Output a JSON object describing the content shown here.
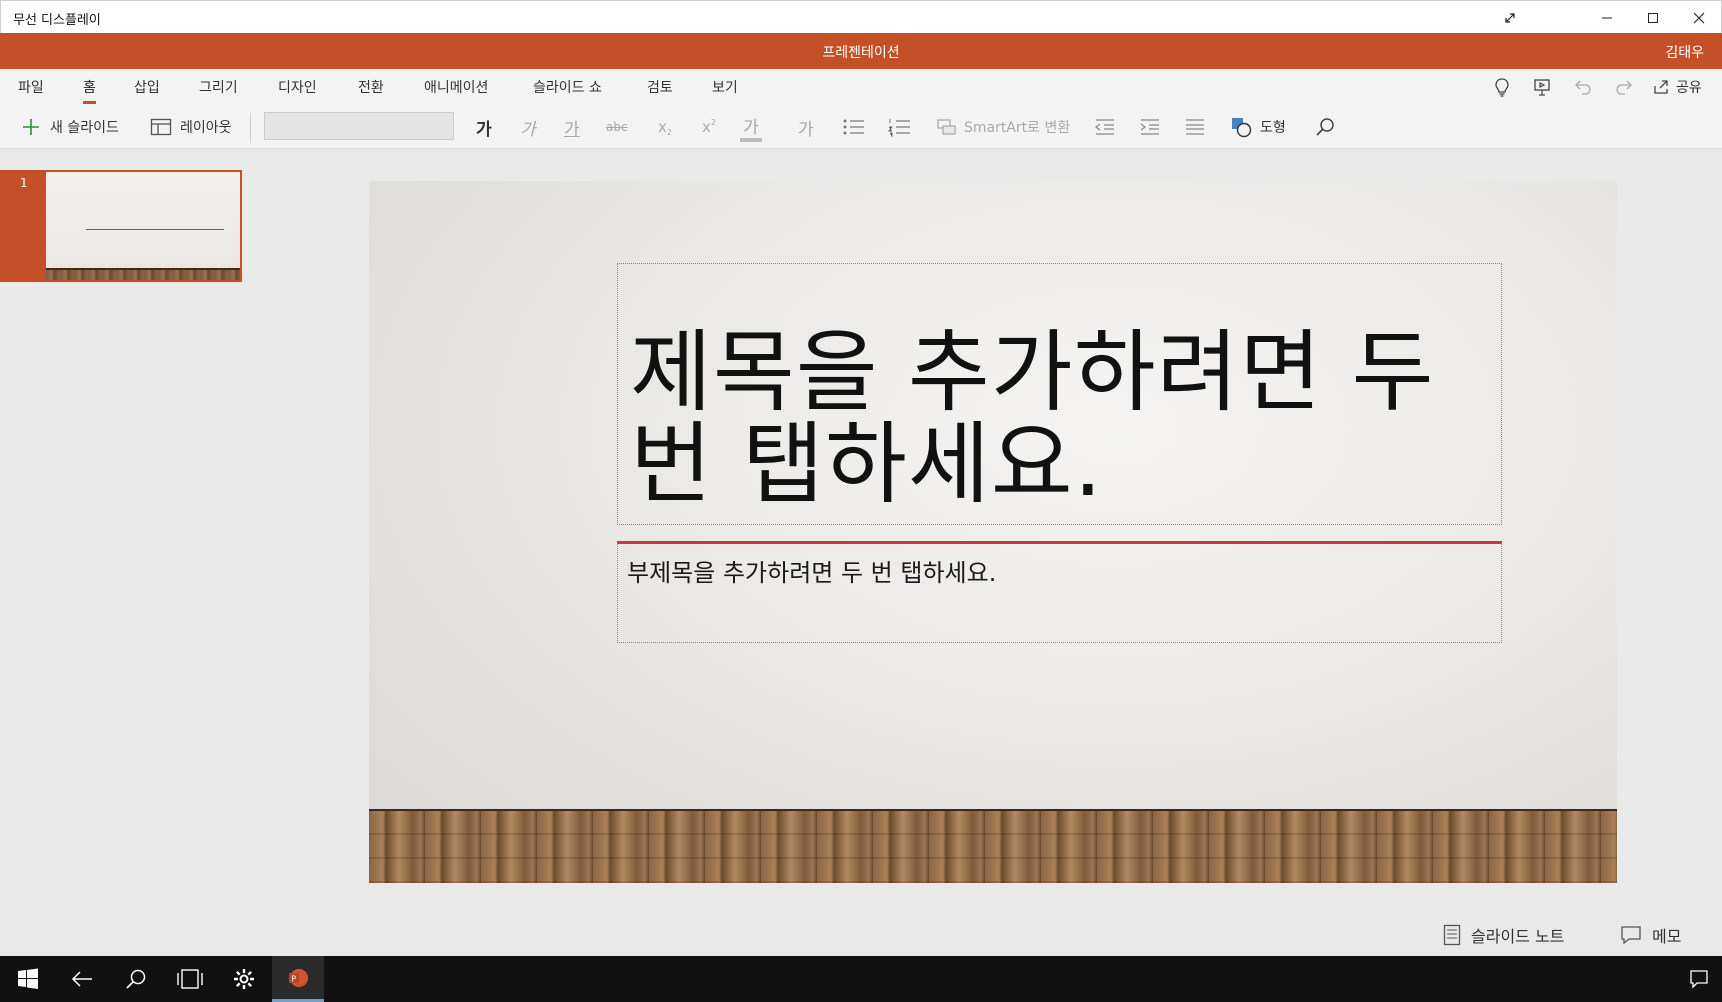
{
  "window": {
    "title": "무선 디스플레이"
  },
  "app": {
    "doc_title": "프레젠테이션",
    "user": "김태우"
  },
  "tabs": [
    {
      "label": "파일",
      "active": false
    },
    {
      "label": "홈",
      "active": true
    },
    {
      "label": "삽입",
      "active": false
    },
    {
      "label": "그리기",
      "active": false
    },
    {
      "label": "디자인",
      "active": false
    },
    {
      "label": "전환",
      "active": false
    },
    {
      "label": "애니메이션",
      "active": false
    },
    {
      "label": "슬라이드 쇼",
      "active": false
    },
    {
      "label": "검토",
      "active": false
    },
    {
      "label": "보기",
      "active": false
    }
  ],
  "share_label": "공유",
  "ribbon": {
    "new_slide": "새 슬라이드",
    "layout": "레이아웃",
    "font_name": "",
    "bold_glyph": "가",
    "italic_glyph": "가",
    "underline_glyph": "가",
    "strike_glyph": "abc",
    "subscript_glyph": "x",
    "superscript_glyph": "x",
    "highlight_glyph": "가",
    "clear_glyph": "가",
    "smartart": "SmartArt로 변환",
    "shapes": "도형"
  },
  "thumbnails": [
    {
      "number": "1"
    }
  ],
  "slide": {
    "title": "제목을 추가하려면 두 번 탭하세요.",
    "subtitle": "부제목을 추가하려면 두 번 탭하세요."
  },
  "status": {
    "notes": "슬라이드 노트",
    "comments": "메모"
  },
  "colors": {
    "accent": "#c4502a",
    "taskbar": "#111111",
    "subtitle_line": "#c8344a"
  }
}
